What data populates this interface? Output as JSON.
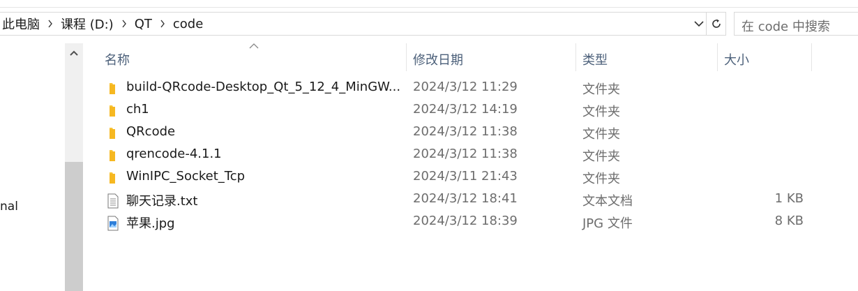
{
  "breadcrumb": {
    "items": [
      "此电脑",
      "课程 (D:)",
      "QT",
      "code"
    ]
  },
  "search": {
    "placeholder": "在 code 中搜索"
  },
  "nav": {
    "partial_label": "nal"
  },
  "columns": {
    "name": "名称",
    "date": "修改日期",
    "type": "类型",
    "size": "大小"
  },
  "files": [
    {
      "name": "build-QRcode-Desktop_Qt_5_12_4_MinGW...",
      "date": "2024/3/12 11:29",
      "type": "文件夹",
      "size": "",
      "icon": "folder-icon"
    },
    {
      "name": "ch1",
      "date": "2024/3/12 14:19",
      "type": "文件夹",
      "size": "",
      "icon": "folder-icon"
    },
    {
      "name": "QRcode",
      "date": "2024/3/12 11:38",
      "type": "文件夹",
      "size": "",
      "icon": "folder-icon"
    },
    {
      "name": "qrencode-4.1.1",
      "date": "2024/3/12 11:38",
      "type": "文件夹",
      "size": "",
      "icon": "folder-icon"
    },
    {
      "name": "WinIPC_Socket_Tcp",
      "date": "2024/3/11 21:43",
      "type": "文件夹",
      "size": "",
      "icon": "folder-icon"
    },
    {
      "name": "聊天记录.txt",
      "date": "2024/3/12 18:41",
      "type": "文本文档",
      "size": "1 KB",
      "icon": "text-file-icon"
    },
    {
      "name": "苹果.jpg",
      "date": "2024/3/12 18:39",
      "type": "JPG 文件",
      "size": "8 KB",
      "icon": "image-file-icon"
    }
  ],
  "colors": {
    "folder": "#f8c53a",
    "header_text": "#4c607a",
    "secondary_text": "#6d6d6d",
    "border": "#d9d9d9"
  }
}
